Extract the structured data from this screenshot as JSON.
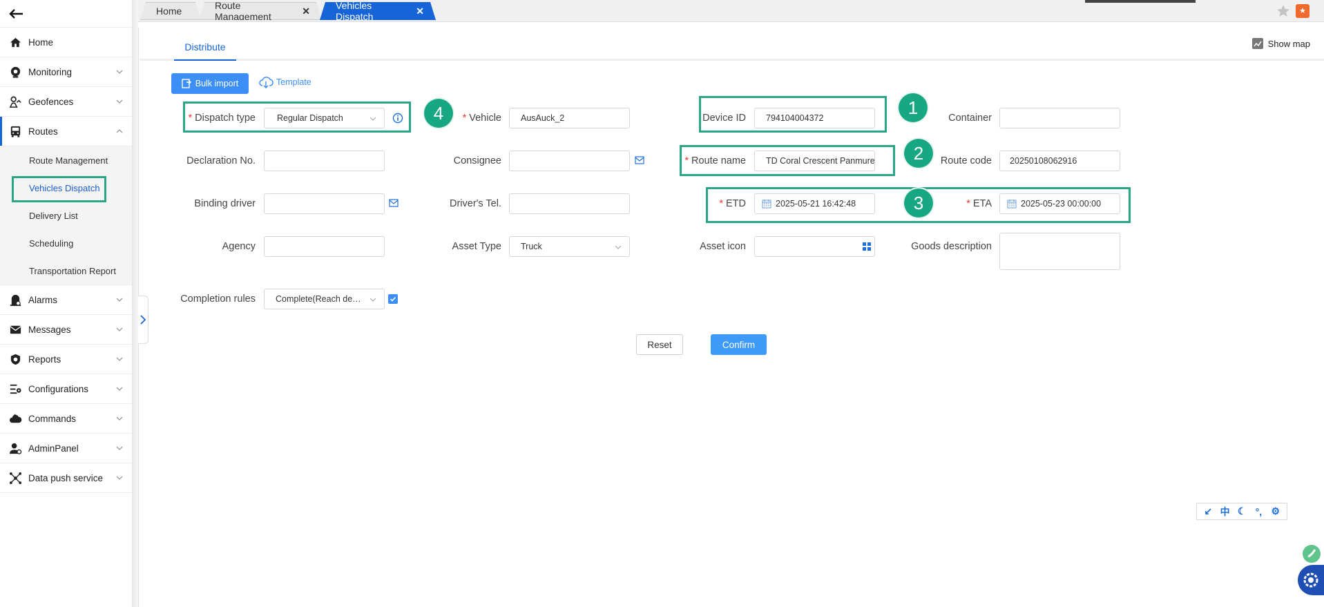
{
  "sidebar": {
    "items": [
      {
        "label": "Home",
        "icon": "home-icon"
      },
      {
        "label": "Monitoring",
        "icon": "camera-icon"
      },
      {
        "label": "Geofences",
        "icon": "geofence-icon"
      },
      {
        "label": "Routes",
        "icon": "bus-icon"
      },
      {
        "label": "Alarms",
        "icon": "alarm-icon"
      },
      {
        "label": "Messages",
        "icon": "envelope-icon"
      },
      {
        "label": "Reports",
        "icon": "shield-icon"
      },
      {
        "label": "Configurations",
        "icon": "config-icon"
      },
      {
        "label": "Commands",
        "icon": "cloud-command-icon"
      },
      {
        "label": "AdminPanel",
        "icon": "admin-icon"
      },
      {
        "label": "Data push service",
        "icon": "data-push-icon"
      }
    ],
    "routes_sub": [
      "Route Management",
      "Vehicles Dispatch",
      "Delivery List",
      "Scheduling",
      "Transportation Report"
    ]
  },
  "tabs": [
    {
      "label": "Home"
    },
    {
      "label": "Route Management",
      "close": "✕"
    },
    {
      "label": "Vehicles Dispatch",
      "close": "✕"
    }
  ],
  "header": {
    "subtab": "Distribute",
    "show_map": "Show map"
  },
  "actions": {
    "bulk_import": "Bulk import",
    "template": "Template"
  },
  "form": {
    "dispatch_type": {
      "label": "Dispatch type",
      "value": "Regular Dispatch"
    },
    "vehicle": {
      "label": "Vehicle",
      "value": "AusAuck_2"
    },
    "device_id": {
      "label": "Device ID",
      "value": "794104004372"
    },
    "container": {
      "label": "Container",
      "value": ""
    },
    "declaration_no": {
      "label": "Declaration No.",
      "value": ""
    },
    "consignee": {
      "label": "Consignee",
      "value": ""
    },
    "route_name": {
      "label": "Route name",
      "value": "TD Coral Crescent Panmure"
    },
    "route_code": {
      "label": "Route code",
      "value": "20250108062916"
    },
    "binding_driver": {
      "label": "Binding driver",
      "value": ""
    },
    "drivers_tel": {
      "label": "Driver's Tel.",
      "value": ""
    },
    "etd": {
      "label": "ETD",
      "value": "2025-05-21 16:42:48"
    },
    "eta": {
      "label": "ETA",
      "value": "2025-05-23 00:00:00"
    },
    "agency": {
      "label": "Agency",
      "value": ""
    },
    "asset_type": {
      "label": "Asset Type",
      "value": "Truck"
    },
    "asset_icon": {
      "label": "Asset icon",
      "value": ""
    },
    "goods_description": {
      "label": "Goods description",
      "value": ""
    },
    "completion_rules": {
      "label": "Completion rules",
      "value": "Complete(Reach destination)"
    }
  },
  "required_mark": "*",
  "badges": [
    "1",
    "2",
    "3",
    "4"
  ],
  "buttons": {
    "reset": "Reset",
    "confirm": "Confirm"
  },
  "float_toolbar": [
    "↙",
    "中",
    "☾",
    "°,",
    "⚙"
  ],
  "colors": {
    "accent": "#1664d8",
    "button": "#3d8ef5",
    "highlight": "#2aa585",
    "badge": "#17a782"
  }
}
